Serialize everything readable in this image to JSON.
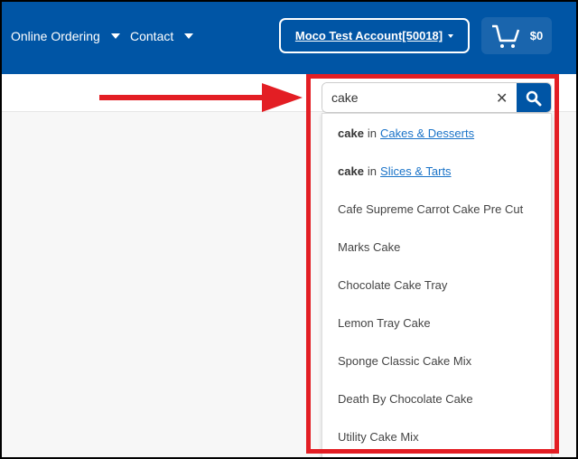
{
  "header": {
    "nav": [
      {
        "label": "Online Ordering",
        "icon": "caret-down-icon"
      },
      {
        "label": "Contact",
        "icon": "caret-down-icon"
      }
    ],
    "account_label": "Moco Test Account[50018]",
    "cart_total": "$0",
    "colors": {
      "brand": "#0055a5",
      "annotation": "#e31e24",
      "link": "#1a73c8"
    }
  },
  "search": {
    "value": "cake",
    "clear_icon": "close-icon",
    "button_icon": "search-icon"
  },
  "suggestions": {
    "categories": [
      {
        "term": "cake",
        "in": "in",
        "category": "Cakes & Desserts"
      },
      {
        "term": "cake",
        "in": "in",
        "category": "Slices & Tarts"
      }
    ],
    "products": [
      "Cafe Supreme Carrot Cake Pre Cut",
      "Marks Cake",
      "Chocolate Cake Tray",
      "Lemon Tray Cake",
      "Sponge Classic Cake Mix",
      "Death By Chocolate Cake",
      "Utility Cake Mix"
    ]
  }
}
